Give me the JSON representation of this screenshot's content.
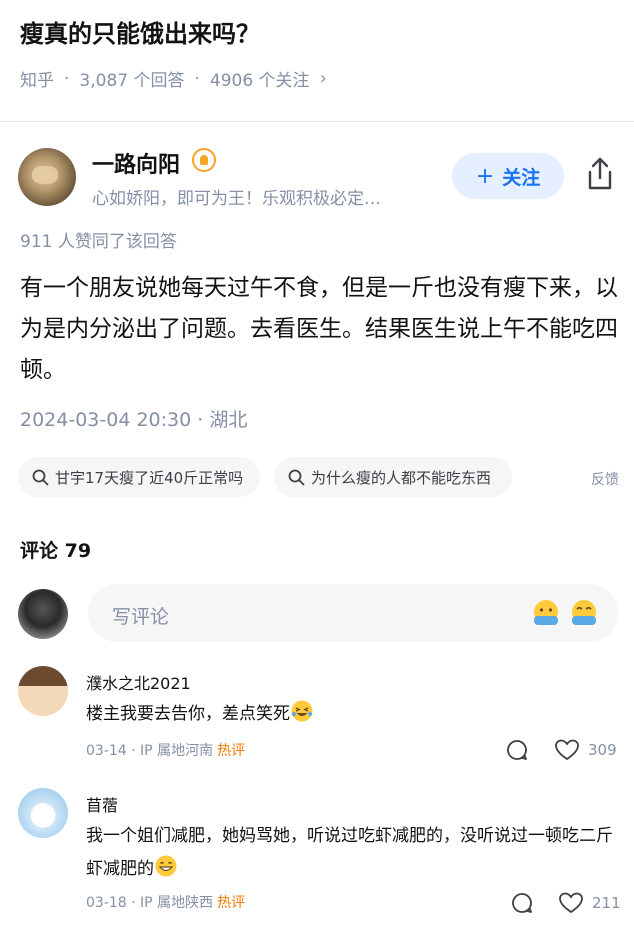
{
  "question": {
    "title": "瘦真的只能饿出来吗？",
    "source": "知乎",
    "answers": "3,087 个回答",
    "followers": "4906 个关注",
    "chevron": "›"
  },
  "answer": {
    "author": "一路向阳",
    "bio": "心如娇阳，即可为王！乐观积极必定…",
    "follow_label": "关注",
    "agree": "911 人赞同了该回答",
    "content": "有一个朋友说她每天过午不食，但是一斤也没有瘦下来，以为是内分泌出了问题。去看医生。结果医生说上午不能吃四顿。",
    "time": "2024-03-04 20:30 · 湖北"
  },
  "related": [
    {
      "label": "甘宇17天瘦了近40斤正常吗"
    },
    {
      "label": "为什么瘦的人都不能吃东西"
    }
  ],
  "feedback_label": "反馈",
  "comments": {
    "title": "评论 79",
    "input_placeholder": "写评论",
    "emoji_labels": [
      "谢谢",
      "赞同"
    ],
    "items": [
      {
        "name": "濮水之北2021",
        "text": "楼主我要去告你，差点笑死",
        "date": "03-14",
        "location": "IP 属地河南",
        "tag": "热评",
        "likes": "309"
      },
      {
        "name": "苜蓿",
        "text": "我一个姐们减肥，她妈骂她，听说过吃虾减肥的，没听说过一顿吃二斤虾减肥的",
        "date": "03-18",
        "location": "IP 属地陕西",
        "tag": "热评",
        "likes": "211"
      }
    ]
  },
  "colors": {
    "accent": "#1772f6",
    "follow_bg": "#e6efff",
    "muted": "#8590a6",
    "hot": "#ff7a00"
  }
}
